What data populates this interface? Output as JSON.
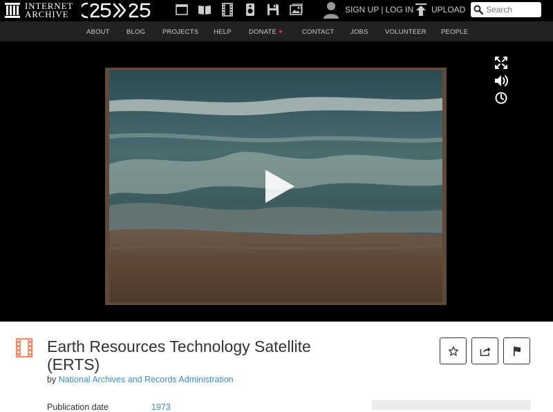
{
  "topnav": {
    "logo_line1": "INTERNET",
    "logo_line2": "ARCHIVE",
    "media_icons": [
      "web-icon",
      "texts-icon",
      "video-icon",
      "audio-icon",
      "software-icon",
      "images-icon"
    ],
    "sign_up": "SIGN UP",
    "separator": "|",
    "log_in": "LOG IN",
    "upload": "UPLOAD",
    "search_placeholder": "Search"
  },
  "subnav": {
    "items": [
      "ABOUT",
      "BLOG",
      "PROJECTS",
      "HELP",
      "DONATE",
      "CONTACT",
      "JOBS",
      "VOLUNTEER",
      "PEOPLE"
    ]
  },
  "player": {
    "controls": [
      "fullscreen-icon",
      "volume-icon",
      "clock-icon"
    ]
  },
  "item": {
    "title": "Earth Resources Technology Satellite (ERTS)",
    "by_prefix": "by",
    "creator": "National Archives and Records Administration",
    "actions": [
      "favorite-icon",
      "share-icon",
      "flag-icon"
    ],
    "metadata": [
      {
        "label": "Publication date",
        "value": "1973"
      }
    ]
  },
  "colors": {
    "topbar": "#000000",
    "subnav": "#222222",
    "link": "#428bca",
    "donate_heart": "#e5342a"
  }
}
